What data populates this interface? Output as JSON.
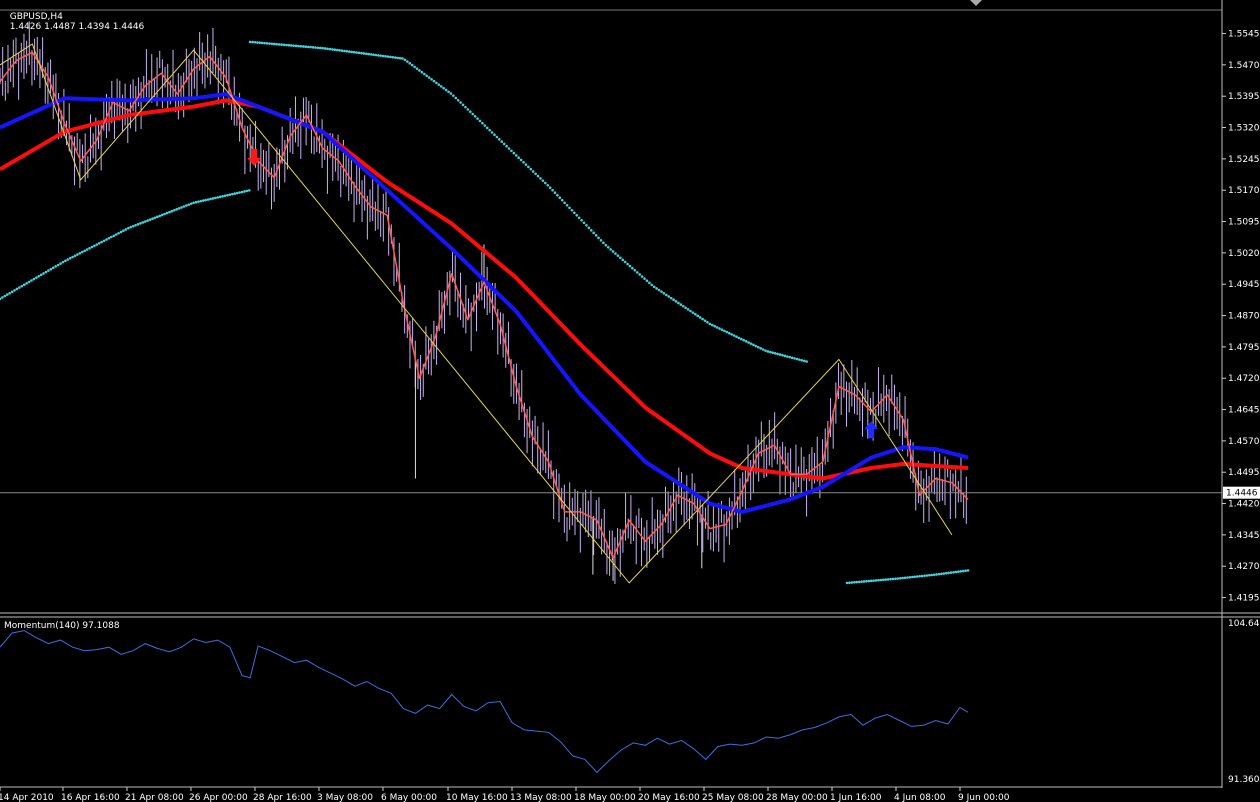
{
  "header": {
    "symbol": "GBPUSD,H4",
    "ohlc": "1.4426 1.4487 1.4394 1.4446",
    "indicator": "Momentum(140) 97.1088"
  },
  "colors": {
    "background": "#000000",
    "axis": "#ffffff",
    "bars": "#c9b3f0",
    "zigzag": "#e6d64a",
    "fast_ma": "#ff5a5a",
    "ma_blue": "#1515ff",
    "ma_red": "#ff0d0d",
    "envelope": "#41d2dc",
    "momentum": "#3b6fe0",
    "price_line": "#8a8a8a"
  },
  "chart_data": [
    {
      "type": "line",
      "name": "GBPUSD H4 price",
      "y_ticks": [
        "1.5545",
        "1.5470",
        "1.5395",
        "1.5320",
        "1.5245",
        "1.5170",
        "1.5095",
        "1.5020",
        "1.4945",
        "1.4870",
        "1.4795",
        "1.4720",
        "1.4645",
        "1.4570",
        "1.4495",
        "1.4420",
        "1.4345",
        "1.4270",
        "1.4195"
      ],
      "ylim": [
        1.417,
        1.5575
      ],
      "current_price_label": "1.4446",
      "current_price": 1.4446,
      "x_labels": [
        "14 Apr 2010",
        "16 Apr 16:00",
        "21 Apr 08:00",
        "26 Apr 00:00",
        "28 Apr 16:00",
        "3 May 08:00",
        "6 May 00:00",
        "10 May 16:00",
        "13 May 08:00",
        "18 May 00:00",
        "20 May 16:00",
        "25 May 08:00",
        "28 May 00:00",
        "1 Jun 16:00",
        "4 Jun 08:00",
        "9 Jun 00:00"
      ],
      "x_range": [
        0,
        240
      ],
      "price": [
        [
          0,
          1.543
        ],
        [
          4,
          1.548
        ],
        [
          8,
          1.55
        ],
        [
          12,
          1.544
        ],
        [
          16,
          1.533
        ],
        [
          20,
          1.524
        ],
        [
          24,
          1.529
        ],
        [
          28,
          1.538
        ],
        [
          32,
          1.536
        ],
        [
          36,
          1.542
        ],
        [
          40,
          1.545
        ],
        [
          44,
          1.54
        ],
        [
          48,
          1.546
        ],
        [
          52,
          1.549
        ],
        [
          56,
          1.544
        ],
        [
          60,
          1.532
        ],
        [
          64,
          1.524
        ],
        [
          68,
          1.52
        ],
        [
          72,
          1.53
        ],
        [
          76,
          1.535
        ],
        [
          80,
          1.527
        ],
        [
          84,
          1.524
        ],
        [
          88,
          1.518
        ],
        [
          92,
          1.513
        ],
        [
          96,
          1.511
        ],
        [
          100,
          1.49
        ],
        [
          104,
          1.472
        ],
        [
          108,
          1.482
        ],
        [
          112,
          1.497
        ],
        [
          116,
          1.486
        ],
        [
          120,
          1.495
        ],
        [
          124,
          1.485
        ],
        [
          128,
          1.47
        ],
        [
          132,
          1.458
        ],
        [
          136,
          1.452
        ],
        [
          140,
          1.44
        ],
        [
          144,
          1.44
        ],
        [
          148,
          1.438
        ],
        [
          152,
          1.429
        ],
        [
          156,
          1.438
        ],
        [
          160,
          1.433
        ],
        [
          164,
          1.437
        ],
        [
          168,
          1.444
        ],
        [
          172,
          1.442
        ],
        [
          176,
          1.436
        ],
        [
          180,
          1.437
        ],
        [
          184,
          1.445
        ],
        [
          188,
          1.454
        ],
        [
          192,
          1.456
        ],
        [
          196,
          1.449
        ],
        [
          200,
          1.449
        ],
        [
          204,
          1.452
        ],
        [
          208,
          1.47
        ],
        [
          212,
          1.468
        ],
        [
          216,
          1.464
        ],
        [
          220,
          1.468
        ],
        [
          224,
          1.462
        ],
        [
          228,
          1.444
        ],
        [
          232,
          1.448
        ],
        [
          236,
          1.447
        ],
        [
          240,
          1.443
        ]
      ],
      "zigzag": [
        [
          0,
          1.547
        ],
        [
          8,
          1.552
        ],
        [
          20,
          1.5195
        ],
        [
          48,
          1.5505
        ],
        [
          156,
          1.423
        ],
        [
          208,
          1.4765
        ],
        [
          236,
          1.4345
        ]
      ],
      "ma_blue": [
        [
          0,
          1.532
        ],
        [
          16,
          1.539
        ],
        [
          32,
          1.5385
        ],
        [
          48,
          1.539
        ],
        [
          56,
          1.54
        ],
        [
          64,
          1.537
        ],
        [
          80,
          1.531
        ],
        [
          96,
          1.517
        ],
        [
          112,
          1.503
        ],
        [
          128,
          1.488
        ],
        [
          144,
          1.468
        ],
        [
          160,
          1.452
        ],
        [
          176,
          1.442
        ],
        [
          184,
          1.44
        ],
        [
          196,
          1.443
        ],
        [
          204,
          1.446
        ],
        [
          216,
          1.453
        ],
        [
          224,
          1.4555
        ],
        [
          232,
          1.455
        ],
        [
          240,
          1.453
        ]
      ],
      "ma_red": [
        [
          0,
          1.522
        ],
        [
          16,
          1.531
        ],
        [
          32,
          1.535
        ],
        [
          48,
          1.537
        ],
        [
          56,
          1.5385
        ],
        [
          64,
          1.537
        ],
        [
          80,
          1.531
        ],
        [
          96,
          1.519
        ],
        [
          112,
          1.509
        ],
        [
          128,
          1.496
        ],
        [
          144,
          1.48
        ],
        [
          160,
          1.465
        ],
        [
          176,
          1.454
        ],
        [
          184,
          1.4505
        ],
        [
          196,
          1.449
        ],
        [
          204,
          1.448
        ],
        [
          216,
          1.4505
        ],
        [
          224,
          1.4515
        ],
        [
          232,
          1.451
        ],
        [
          240,
          1.4505
        ]
      ],
      "envelope_upper": [
        [
          62,
          1.5525
        ],
        [
          80,
          1.551
        ],
        [
          100,
          1.5485
        ],
        [
          112,
          1.54
        ],
        [
          124,
          1.529
        ],
        [
          136,
          1.518
        ],
        [
          150,
          1.504
        ],
        [
          162,
          1.494
        ],
        [
          176,
          1.485
        ],
        [
          190,
          1.4785
        ],
        [
          200,
          1.476
        ]
      ],
      "envelope_lower_left": [
        [
          0,
          1.491
        ],
        [
          16,
          1.5
        ],
        [
          32,
          1.508
        ],
        [
          48,
          1.514
        ],
        [
          62,
          1.517
        ]
      ],
      "envelope_lower_right": [
        [
          210,
          1.423
        ],
        [
          222,
          1.424
        ],
        [
          232,
          1.425
        ],
        [
          240,
          1.426
        ]
      ],
      "signals": [
        {
          "x": 63,
          "price": 1.524,
          "dir": "down",
          "color": "#ff1a1a"
        },
        {
          "x": 216,
          "price": 1.4605,
          "dir": "up",
          "color": "#1e2bff"
        }
      ]
    },
    {
      "type": "line",
      "name": "Momentum(140)",
      "y_ticks": [
        "104.647",
        "91.3609"
      ],
      "ylim": [
        91.3609,
        104.647
      ],
      "values": [
        [
          0,
          102.6
        ],
        [
          3,
          103.8
        ],
        [
          6,
          104.0
        ],
        [
          9,
          103.4
        ],
        [
          12,
          102.9
        ],
        [
          15,
          103.2
        ],
        [
          18,
          102.6
        ],
        [
          21,
          102.3
        ],
        [
          24,
          102.4
        ],
        [
          27,
          102.6
        ],
        [
          30,
          102.0
        ],
        [
          33,
          102.3
        ],
        [
          36,
          102.9
        ],
        [
          39,
          102.5
        ],
        [
          42,
          102.2
        ],
        [
          45,
          102.6
        ],
        [
          48,
          103.3
        ],
        [
          51,
          103.0
        ],
        [
          54,
          103.2
        ],
        [
          57,
          102.6
        ],
        [
          60,
          100.2
        ],
        [
          62,
          100.0
        ],
        [
          64,
          102.7
        ],
        [
          67,
          102.3
        ],
        [
          70,
          101.8
        ],
        [
          73,
          101.3
        ],
        [
          76,
          101.5
        ],
        [
          79,
          100.9
        ],
        [
          82,
          100.4
        ],
        [
          85,
          99.9
        ],
        [
          88,
          99.3
        ],
        [
          91,
          99.7
        ],
        [
          94,
          99.1
        ],
        [
          97,
          98.7
        ],
        [
          100,
          97.4
        ],
        [
          103,
          97.0
        ],
        [
          106,
          97.7
        ],
        [
          109,
          97.4
        ],
        [
          112,
          98.6
        ],
        [
          115,
          97.6
        ],
        [
          118,
          97.2
        ],
        [
          121,
          97.9
        ],
        [
          124,
          98.0
        ],
        [
          127,
          96.2
        ],
        [
          130,
          95.6
        ],
        [
          133,
          95.5
        ],
        [
          136,
          95.4
        ],
        [
          139,
          94.6
        ],
        [
          142,
          93.4
        ],
        [
          145,
          93.1
        ],
        [
          148,
          92.0
        ],
        [
          151,
          93.0
        ],
        [
          154,
          93.9
        ],
        [
          157,
          94.5
        ],
        [
          160,
          94.3
        ],
        [
          163,
          94.9
        ],
        [
          166,
          94.4
        ],
        [
          169,
          94.7
        ],
        [
          172,
          94.0
        ],
        [
          175,
          93.1
        ],
        [
          178,
          94.2
        ],
        [
          181,
          94.4
        ],
        [
          184,
          94.3
        ],
        [
          187,
          94.5
        ],
        [
          190,
          95.0
        ],
        [
          193,
          94.9
        ],
        [
          196,
          95.2
        ],
        [
          199,
          95.6
        ],
        [
          202,
          95.8
        ],
        [
          205,
          96.2
        ],
        [
          208,
          96.7
        ],
        [
          211,
          96.9
        ],
        [
          214,
          96.0
        ],
        [
          217,
          96.6
        ],
        [
          220,
          96.9
        ],
        [
          223,
          96.4
        ],
        [
          226,
          95.9
        ],
        [
          229,
          96.0
        ],
        [
          232,
          96.4
        ],
        [
          235,
          96.1
        ],
        [
          238,
          97.5
        ],
        [
          240,
          97.1
        ]
      ]
    }
  ]
}
